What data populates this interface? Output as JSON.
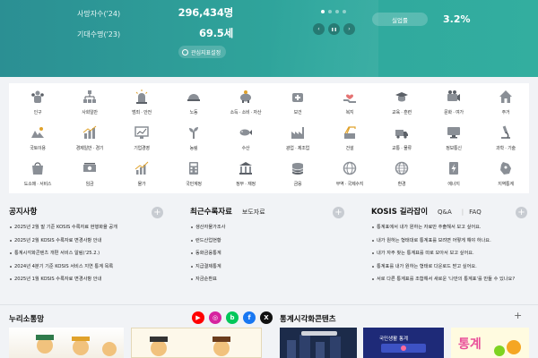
{
  "hero": {
    "stats": [
      {
        "label": "사망자수('24)",
        "value": "296,434명"
      },
      {
        "label": "기대수명('23)",
        "value": "69.5세"
      }
    ],
    "settings_button": "관심지표설정",
    "unemployment": {
      "label": "실업률",
      "value": "3.2%"
    },
    "controls": {
      "prev": "‹",
      "pause": "❚❚",
      "next": "›"
    }
  },
  "categories": [
    {
      "label": "인구",
      "icon": "people-icon"
    },
    {
      "label": "사회일반",
      "icon": "organization-icon"
    },
    {
      "label": "범죄 · 안전",
      "icon": "siren-icon"
    },
    {
      "label": "노동",
      "icon": "helmet-icon"
    },
    {
      "label": "소득 · 소비 · 자산",
      "icon": "piggy-bank-icon"
    },
    {
      "label": "보건",
      "icon": "health-icon"
    },
    {
      "label": "복지",
      "icon": "heart-hands-icon"
    },
    {
      "label": "교육 · 훈련",
      "icon": "graduation-icon"
    },
    {
      "label": "문화 · 여가",
      "icon": "camera-icon"
    },
    {
      "label": "주거",
      "icon": "house-icon"
    },
    {
      "label": "국토이용",
      "icon": "land-icon"
    },
    {
      "label": "경제일반 · 경기",
      "icon": "economy-icon"
    },
    {
      "label": "기업경영",
      "icon": "business-chart-icon"
    },
    {
      "label": "농림",
      "icon": "plant-icon"
    },
    {
      "label": "수산",
      "icon": "fish-icon"
    },
    {
      "label": "광업 · 제조업",
      "icon": "factory-icon"
    },
    {
      "label": "건설",
      "icon": "construction-icon"
    },
    {
      "label": "교통 · 물류",
      "icon": "truck-icon"
    },
    {
      "label": "정보통신",
      "icon": "monitor-icon"
    },
    {
      "label": "과학 · 기술",
      "icon": "microscope-icon"
    },
    {
      "label": "도소매 · 서비스",
      "icon": "shopping-icon"
    },
    {
      "label": "임금",
      "icon": "money-icon"
    },
    {
      "label": "물가",
      "icon": "price-chart-icon"
    },
    {
      "label": "국민계정",
      "icon": "calculator-icon"
    },
    {
      "label": "정부 · 재정",
      "icon": "government-icon"
    },
    {
      "label": "금융",
      "icon": "coins-icon"
    },
    {
      "label": "무역 · 국제수지",
      "icon": "globe-icon"
    },
    {
      "label": "환경",
      "icon": "leaf-globe-icon"
    },
    {
      "label": "에너지",
      "icon": "energy-icon"
    },
    {
      "label": "지역통계",
      "icon": "region-map-icon"
    }
  ],
  "notice": {
    "title": "공지사항",
    "items": [
      "2025년 2월 말 기준 KOSIS 수록자료 현행화율 공개",
      "2025년 2월 KOSIS 수록자료 변경사항 안내",
      "통계시각화콘텐츠 개편 서비스 알림('25.2.)",
      "2024년 4분기 기준 KOSIS 서비스 지연 통계 목록",
      "2025년 1월 KOSIS 수록자료 변경사항 안내"
    ]
  },
  "recent": {
    "title": "최근수록자료",
    "tab2": "보도자료",
    "items": [
      "생산자물가조사",
      "런드산업현황",
      "동화금융통계",
      "지급결제통계",
      "자금순환표"
    ]
  },
  "guide": {
    "title": "KOSIS 길라잡이",
    "tab_qa": "Q&A",
    "tab_faq": "FAQ",
    "items": [
      "통계표에서 내가 원하는 자료만 추출해서 보고 싶어요.",
      "내가 원하는 형태대로 통계표를 보려면 어떻게 해야 하나요.",
      "내가 자주 찾는 통계표를 따로 모아서 보고 싶어요.",
      "통계표를 내가 원하는 형태로 다운로드 받고 싶어요.",
      "서로 다른 통계표를 조합해서 새로운 '나만의 통계표'를 만들 수 있나요?"
    ]
  },
  "sns_section": {
    "title": "누리소통망",
    "buttons": [
      {
        "name": "youtube",
        "glyph": "▶",
        "color": "#ff0000"
      },
      {
        "name": "instagram",
        "glyph": "◎",
        "color": "#d6249f"
      },
      {
        "name": "blog",
        "glyph": "b",
        "color": "#03c75a"
      },
      {
        "name": "facebook",
        "glyph": "f",
        "color": "#1877f2"
      },
      {
        "name": "x",
        "glyph": "X",
        "color": "#111111"
      }
    ]
  },
  "visual_section": {
    "title": "통계시각화콘텐츠",
    "thumbs": [
      "",
      "국민생활 통계",
      "",
      "통계"
    ]
  },
  "colors": {
    "accent": "#2fa29a",
    "icon": "#8a8f96"
  }
}
